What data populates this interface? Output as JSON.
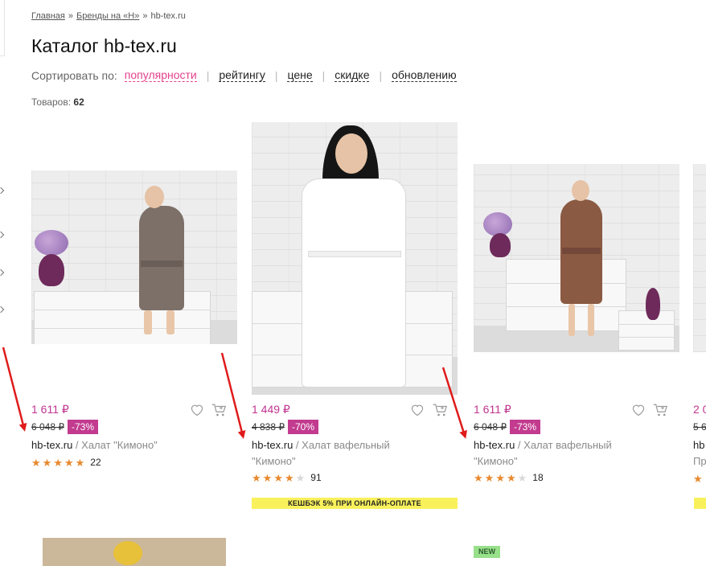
{
  "breadcrumb": {
    "home": "Главная",
    "brands": "Бренды на «Н»",
    "current": "hb-tex.ru",
    "separator": "»"
  },
  "title": "Каталог hb-tex.ru",
  "sort": {
    "label": "Сортировать по:",
    "options": [
      "популярности",
      "рейтингу",
      "цене",
      "скидке",
      "обновлению"
    ],
    "active": "популярности",
    "divider": "|"
  },
  "count": {
    "label": "Товаров:",
    "value": "62"
  },
  "colors": {
    "accent": "#e3418c",
    "price": "#c0348f",
    "discount": "#c23b8f",
    "star": "#e8892e",
    "cashback": "#f9f15c",
    "new_badge": "#98e08a",
    "arrow": "#e01b1b"
  },
  "products": [
    {
      "price": "1 611 ₽",
      "old_price": "6 048 ₽",
      "discount": "-73%",
      "brand": "hb-tex.ru",
      "divider": " / ",
      "name": "Халат \"Кимоно\"",
      "rating": 5,
      "reviews": "22",
      "icons": [
        "heart-icon",
        "cart-icon"
      ]
    },
    {
      "price": "1 449 ₽",
      "old_price": "4 838 ₽",
      "discount": "-70%",
      "brand": "hb-tex.ru",
      "divider": " / ",
      "name": "Халат вафельный \"Кимоно\"",
      "rating": 4,
      "reviews": "91",
      "cashback": "КЕШБЭК 5% ПРИ ОНЛАЙН-ОПЛАТЕ",
      "icons": [
        "heart-icon",
        "cart-icon"
      ]
    },
    {
      "price": "1 611 ₽",
      "old_price": "6 048 ₽",
      "discount": "-73%",
      "brand": "hb-tex.ru",
      "divider": " / ",
      "name": "Халат вафельный \"Кимоно\"",
      "rating": 4,
      "reviews": "18",
      "icons": [
        "heart-icon",
        "cart-icon"
      ]
    }
  ],
  "partial_product": {
    "price": "2 0",
    "old_price": "5 6",
    "brand": "hb",
    "name": "Пр"
  },
  "new_badge": "NEW"
}
